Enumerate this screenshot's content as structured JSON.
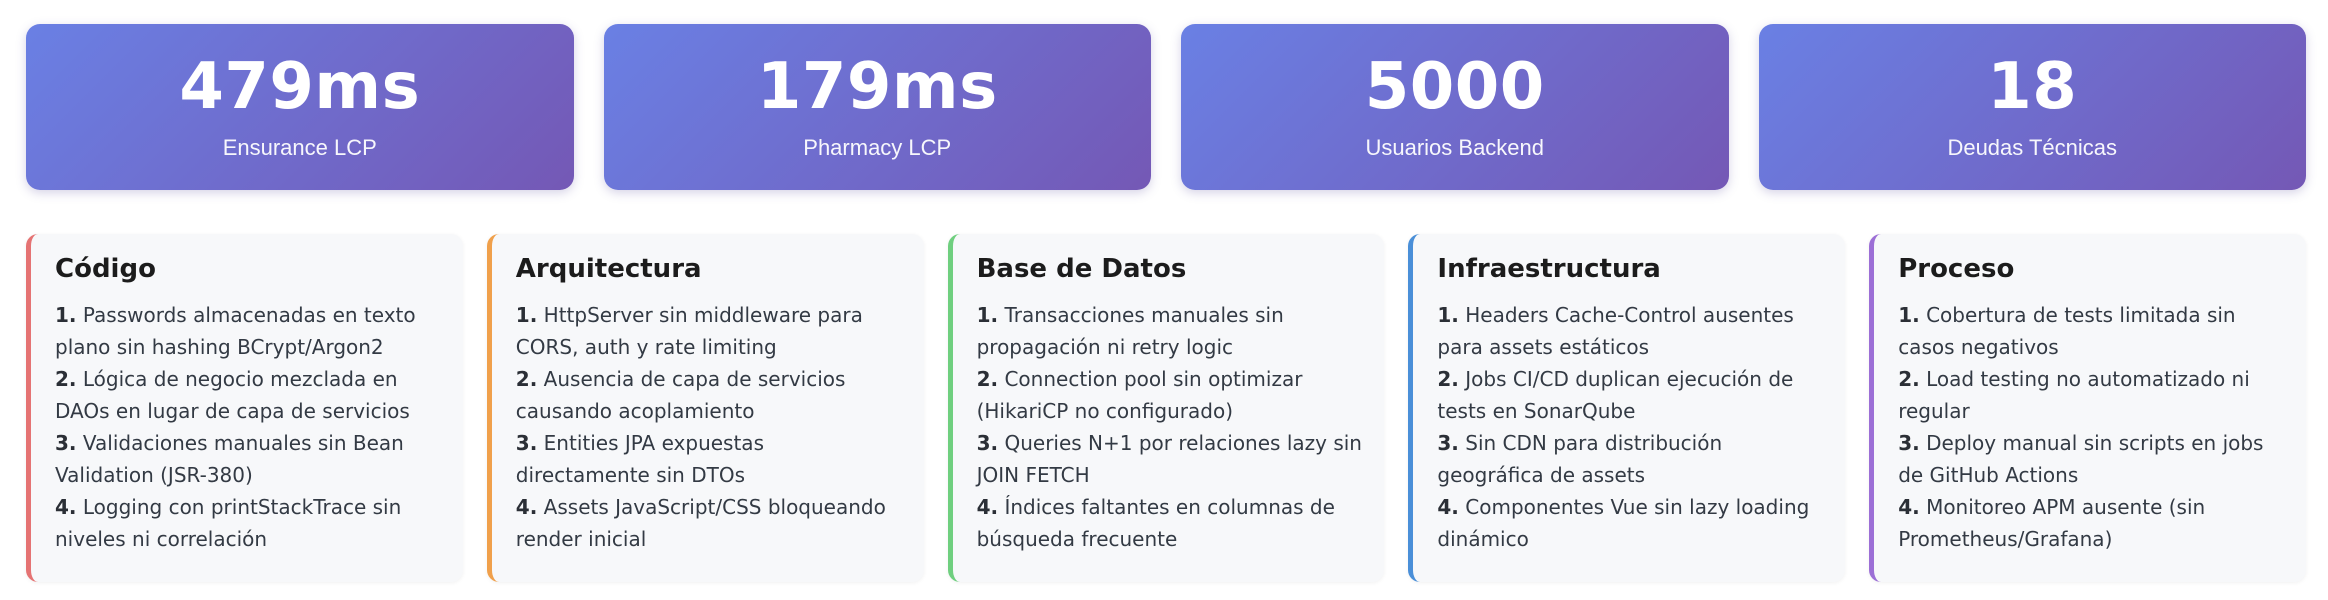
{
  "metrics": [
    {
      "value": "479ms",
      "label": "Ensurance LCP"
    },
    {
      "value": "179ms",
      "label": "Pharmacy LCP"
    },
    {
      "value": "5000",
      "label": "Usuarios Backend"
    },
    {
      "value": "18",
      "label": "Deudas Técnicas"
    }
  ],
  "colors": {
    "metric_gradient_start": "#6a80e4",
    "metric_gradient_end": "#7458b5",
    "codigo": "#e57373",
    "arquitectura": "#f0a04b",
    "base_de_datos": "#6fcf7f",
    "infraestructura": "#4a8fd8",
    "proceso": "#9c6fd6"
  },
  "categories": [
    {
      "title": "Código",
      "items": [
        {
          "num": "1.",
          "text": "Passwords almacenadas en texto plano sin hashing BCrypt/Argon2"
        },
        {
          "num": "2.",
          "text": "Lógica de negocio mezclada en DAOs en lugar de capa de servicios"
        },
        {
          "num": "3.",
          "text": "Validaciones manuales sin Bean Validation (JSR-380)"
        },
        {
          "num": "4.",
          "text": "Logging con printStackTrace sin niveles ni correlación"
        }
      ]
    },
    {
      "title": "Arquitectura",
      "items": [
        {
          "num": "1.",
          "text": "HttpServer sin middleware para CORS, auth y rate limiting"
        },
        {
          "num": "2.",
          "text": "Ausencia de capa de servicios causando acoplamiento"
        },
        {
          "num": "3.",
          "text": "Entities JPA expuestas directamente sin DTOs"
        },
        {
          "num": "4.",
          "text": "Assets JavaScript/CSS bloqueando render inicial"
        }
      ]
    },
    {
      "title": "Base de Datos",
      "items": [
        {
          "num": "1.",
          "text": "Transacciones manuales sin propagación ni retry logic"
        },
        {
          "num": "2.",
          "text": "Connection pool sin optimizar (HikariCP no configurado)"
        },
        {
          "num": "3.",
          "text": "Queries N+1 por relaciones lazy sin JOIN FETCH"
        },
        {
          "num": "4.",
          "text": "Índices faltantes en columnas de búsqueda frecuente"
        }
      ]
    },
    {
      "title": "Infraestructura",
      "items": [
        {
          "num": "1.",
          "text": "Headers Cache-Control ausentes para assets estáticos"
        },
        {
          "num": "2.",
          "text": "Jobs CI/CD duplican ejecución de tests en SonarQube"
        },
        {
          "num": "3.",
          "text": "Sin CDN para distribución geográfica de assets"
        },
        {
          "num": "4.",
          "text": "Componentes Vue sin lazy loading dinámico"
        }
      ]
    },
    {
      "title": "Proceso",
      "items": [
        {
          "num": "1.",
          "text": "Cobertura de tests limitada sin casos negativos"
        },
        {
          "num": "2.",
          "text": "Load testing no automatizado ni regular"
        },
        {
          "num": "3.",
          "text": "Deploy manual sin scripts en jobs de GitHub Actions"
        },
        {
          "num": "4.",
          "text": "Monitoreo APM ausente (sin Prometheus/Grafana)"
        }
      ]
    }
  ]
}
